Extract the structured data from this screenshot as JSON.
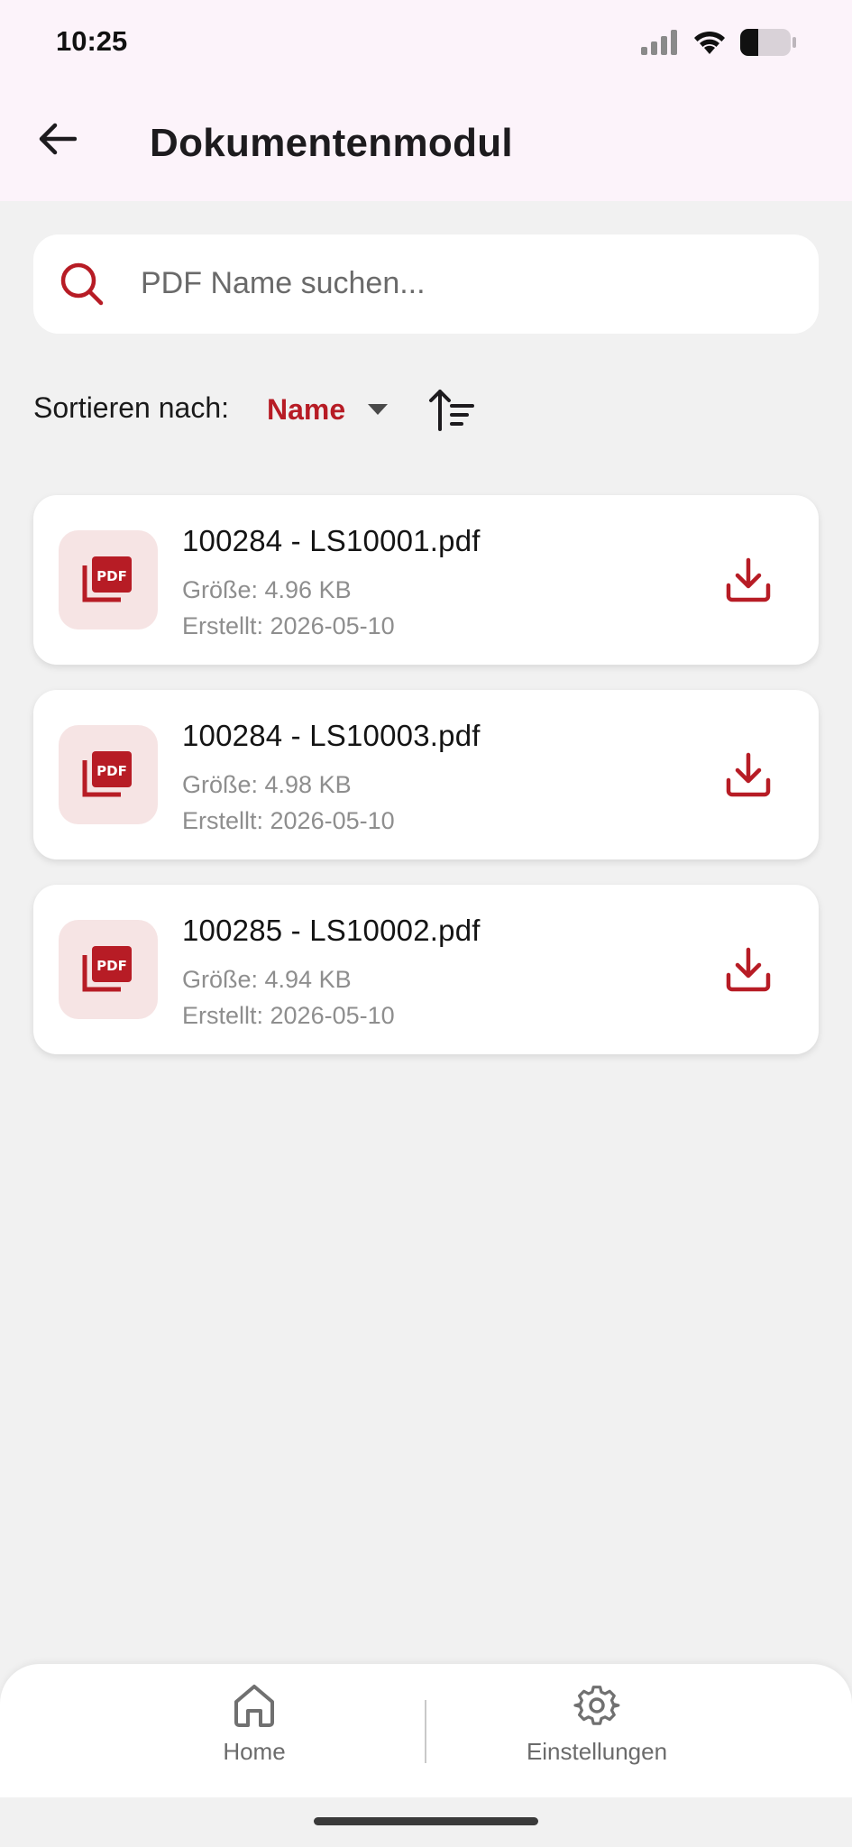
{
  "status_bar": {
    "time": "10:25"
  },
  "header": {
    "title": "Dokumentenmodul"
  },
  "search": {
    "placeholder": "PDF Name suchen..."
  },
  "sort": {
    "label": "Sortieren nach:",
    "value": "Name"
  },
  "documents": [
    {
      "name": "100284 - LS10001.pdf",
      "size": "Größe: 4.96 KB",
      "created": "Erstellt: 2026-05-10"
    },
    {
      "name": "100284 - LS10003.pdf",
      "size": "Größe: 4.98 KB",
      "created": "Erstellt: 2026-05-10"
    },
    {
      "name": "100285 - LS10002.pdf",
      "size": "Größe: 4.94 KB",
      "created": "Erstellt: 2026-05-10"
    }
  ],
  "nav": {
    "home": "Home",
    "settings": "Einstellungen"
  },
  "colors": {
    "accent": "#b71c25",
    "header_bg": "#fcf3fa",
    "page_bg": "#f1f1f1",
    "thumb_bg": "#f6e4e4"
  },
  "icons": {
    "pdf": "pdf-file-icon",
    "download": "download-icon",
    "search": "search-icon",
    "back": "arrow-left-icon",
    "sort_order": "sort-ascending-icon",
    "home": "home-icon",
    "settings": "gear-icon"
  }
}
